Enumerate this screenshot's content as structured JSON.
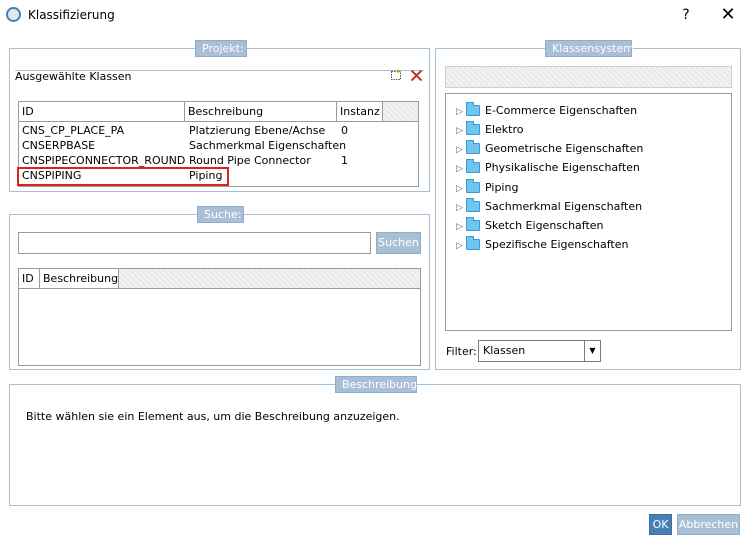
{
  "window": {
    "title": "Klassifizierung",
    "help_label": "?",
    "close_label": "✕"
  },
  "projekt": {
    "group_title": "Projekt:",
    "label": "Ausgewählte Klassen",
    "columns": [
      "ID",
      "Beschreibung",
      "Instanz"
    ],
    "rows": [
      {
        "id": "CNS_CP_PLACE_PA",
        "desc": "Platzierung Ebene/Achse",
        "instanz": "0"
      },
      {
        "id": "CNSERPBASE",
        "desc": "Sachmerkmal Eigenschaften",
        "instanz": ""
      },
      {
        "id": "CNSPIPECONNECTOR_ROUND",
        "desc": "Round Pipe Connector",
        "instanz": "1"
      },
      {
        "id": "CNSPIPING",
        "desc": "Piping",
        "instanz": ""
      }
    ],
    "highlight_color": "#e02020"
  },
  "suche": {
    "group_title": "Suche:",
    "input_value": "",
    "button_label": "Suchen",
    "columns": [
      "ID",
      "Beschreibung"
    ]
  },
  "klassensystem": {
    "group_title": "Klassensystem:",
    "tree": [
      "E-Commerce Eigenschaften",
      "Elektro",
      "Geometrische Eigenschaften",
      "Physikalische Eigenschaften",
      "Piping",
      "Sachmerkmal Eigenschaften",
      "Sketch Eigenschaften",
      "Spezifische Eigenschaften"
    ],
    "filter_label": "Filter:",
    "filter_value": "Klassen"
  },
  "beschreibung": {
    "group_title": "Beschreibung",
    "text": "Bitte wählen sie ein Element aus, um die Beschreibung anzuzeigen."
  },
  "footer": {
    "ok_label": "OK",
    "cancel_label": "Abbrechen"
  }
}
